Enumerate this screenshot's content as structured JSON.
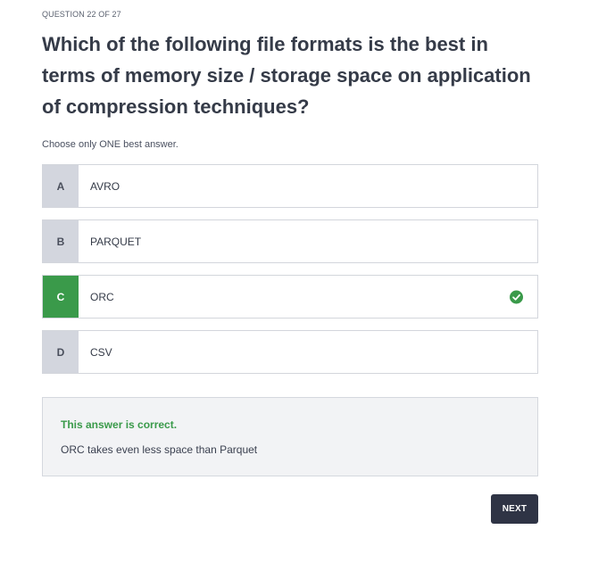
{
  "header": {
    "counter": "QUESTION 22 OF 27"
  },
  "question": {
    "text": "Which of the following file formats is the best in terms of memory size / storage space on application of compression techniques?",
    "instruction": "Choose only ONE best answer."
  },
  "options": [
    {
      "letter": "A",
      "label": "AVRO"
    },
    {
      "letter": "B",
      "label": "PARQUET"
    },
    {
      "letter": "C",
      "label": "ORC",
      "status": "correct"
    },
    {
      "letter": "D",
      "label": "CSV"
    }
  ],
  "icons": {
    "selected_check": "check-circle-icon"
  },
  "colors": {
    "correct": "#3a9a4a",
    "button": "#2f3445"
  },
  "feedback": {
    "title": "This answer is correct.",
    "explanation": "ORC takes even less space than Parquet"
  },
  "actions": {
    "next_label": "NEXT"
  }
}
